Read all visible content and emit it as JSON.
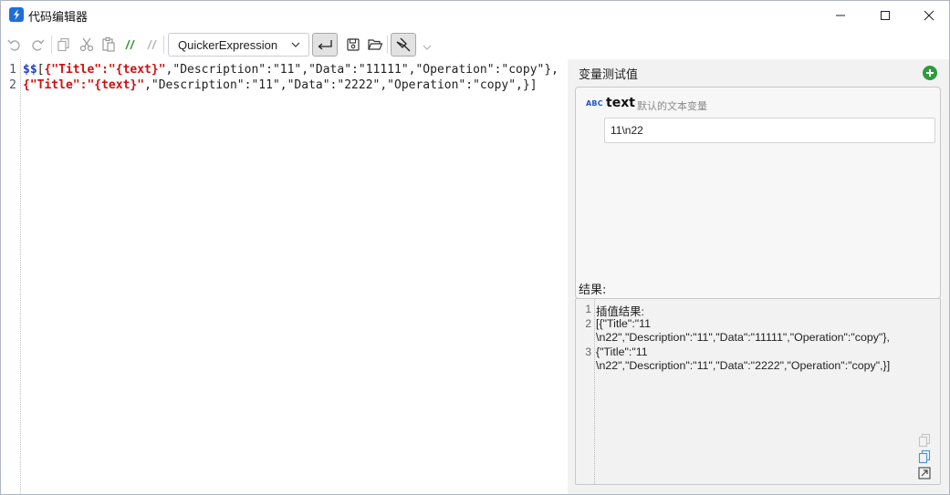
{
  "window": {
    "title": "代码编辑器",
    "icons": {
      "app": "quicker-logo-icon",
      "minimize": "minimize-icon",
      "maximize": "maximize-icon",
      "close": "close-icon"
    }
  },
  "toolbar": {
    "language_select": {
      "value": "QuickerExpression"
    },
    "icons": [
      "undo-icon",
      "redo-icon",
      "copy-icon",
      "cut-icon",
      "paste-icon",
      "comment-icon",
      "uncomment-icon",
      "word-wrap-icon",
      "save-icon",
      "open-folder-icon",
      "pin-icon",
      "more-chevron-icon"
    ]
  },
  "editor": {
    "line_numbers": [
      "1",
      "2"
    ],
    "lines": [
      {
        "dollar": "$$",
        "p1": "[",
        "s1": "{\"Title\":\"{text}\"",
        "p2": ",\"Description\":\"11\",\"Data\":\"11111\",\"Operation\":\"copy\"},"
      },
      {
        "s1": "{\"Title\":\"{text}\"",
        "p2": ",\"Description\":\"11\",\"Data\":\"2222\",\"Operation\":\"copy\",}]"
      }
    ]
  },
  "variables_panel": {
    "title": "变量测试值",
    "variables": [
      {
        "type_badge": "ABC",
        "name": "text",
        "description": "默认的文本变量",
        "value": "11\\n22"
      }
    ]
  },
  "result_panel": {
    "title": "结果:",
    "line_numbers": [
      "1",
      "2",
      "3"
    ],
    "lines": [
      "插值结果:",
      "[{\"Title\":\"11",
      "\\n22\",\"Description\":\"11\",\"Data\":\"11111\",\"Operation\":\"copy\"},",
      "{\"Title\":\"11",
      "\\n22\",\"Description\":\"11\",\"Data\":\"2222\",\"Operation\":\"copy\",}]"
    ]
  },
  "colors": {
    "accent_blue": "#1f6fd6",
    "add_green": "#2e9a3e",
    "code_dollar": "#1f3fd0",
    "code_string": "#d01010",
    "green_comment": "#2f9a3a"
  }
}
